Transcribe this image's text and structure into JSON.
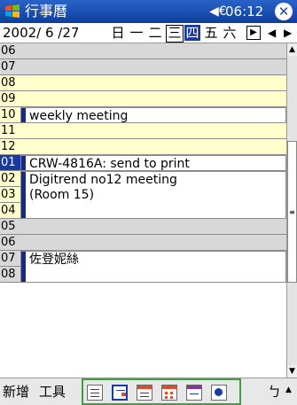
{
  "title_bar": {
    "app_title": "行事曆",
    "clock": "06:12",
    "close_label": "✕",
    "speaker_glyph": "◀€"
  },
  "date_bar": {
    "date": "2002/ 6 /27",
    "weekdays": [
      "日",
      "一",
      "二",
      "三",
      "四",
      "五",
      "六"
    ],
    "today_index": 3,
    "selected_index": 4,
    "goto_today_glyph": "▶",
    "nav_left": "◀",
    "nav_right": "▶"
  },
  "hours": [
    "06",
    "07",
    "08",
    "09",
    "10",
    "11",
    "12",
    "01",
    "02",
    "03",
    "04",
    "05",
    "06",
    "07",
    "08"
  ],
  "appointments": [
    {
      "text": "weekly meeting"
    },
    {
      "text": "CRW-4816A: send to print"
    },
    {
      "text": "Digitrend no12 meeting\n(Room 15)"
    },
    {
      "text": "佐登妮絲"
    }
  ],
  "command_bar": {
    "new_label": "新增",
    "tools_label": "工具",
    "undo_glyph": "ㄅ",
    "views": [
      "agenda-view",
      "day-view",
      "week-view",
      "month-view",
      "year-view",
      "today-view"
    ],
    "active_view_index": 1
  },
  "colors": {
    "title_bar": "#1a4ab0",
    "selection": "#1a3aa0",
    "work_hours": "#ffffcc",
    "off_hours": "#d8d8d8",
    "highlight_frame": "#40a040"
  }
}
